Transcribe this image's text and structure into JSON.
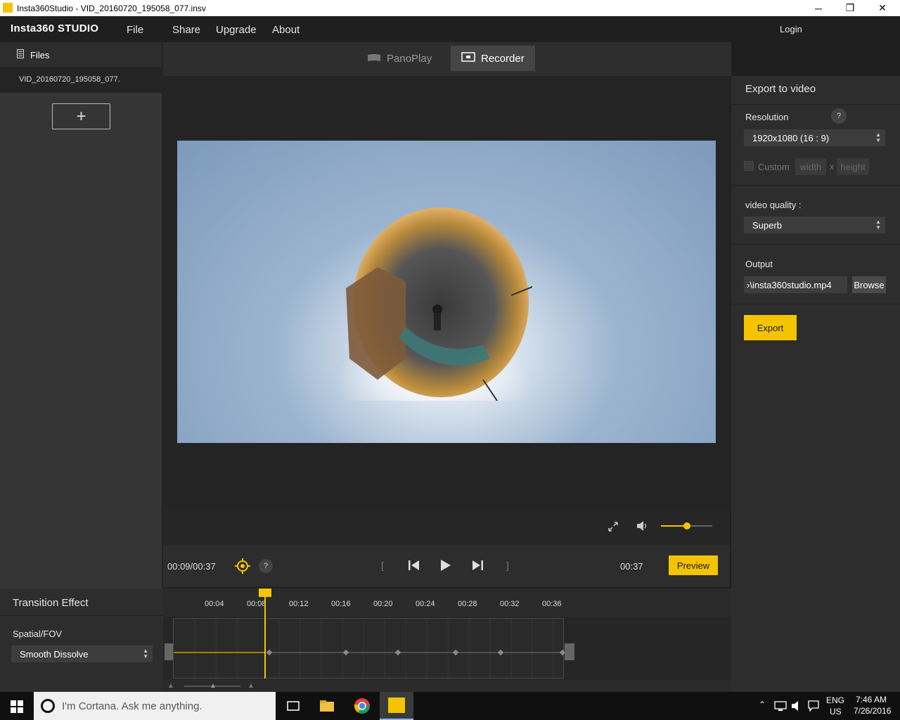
{
  "window": {
    "title": "Insta360Studio - VID_20160720_195058_077.insv",
    "minimize": "─",
    "restore": "❐",
    "close": "✕"
  },
  "menubar": {
    "brand": "Insta360 STUDIO",
    "items": [
      "File",
      "Share",
      "Upgrade",
      "About"
    ],
    "login": "Login"
  },
  "sidebar": {
    "files_label": "Files",
    "file_item": "VID_20160720_195058_077.",
    "add_label": "+"
  },
  "tabs": {
    "panoplay": "PanoPlay",
    "recorder": "Recorder"
  },
  "player": {
    "current_time": "00:09/00:37",
    "end_time": "00:37",
    "preview_label": "Preview",
    "help": "?",
    "volume_level": 0.5
  },
  "export": {
    "header": "Export to video",
    "resolution_label": "Resolution",
    "resolution_help": "?",
    "resolution_value": "1920x1080 (16 : 9)",
    "custom_label": "Custom",
    "width_placeholder": "width",
    "x_label": "x",
    "height_placeholder": "height",
    "quality_label": "video quality :",
    "quality_value": "Superb",
    "output_label": "Output",
    "output_value": "›\\insta360studio.mp4",
    "browse_label": "Browse",
    "export_label": "Export"
  },
  "transition": {
    "header": "Transition Effect",
    "spatial_label": "Spatial/FOV",
    "effect_value": "Smooth Dissolve"
  },
  "timeline": {
    "ticks": [
      "00:04",
      "00:08",
      "00:12",
      "00:16",
      "00:20",
      "00:24",
      "00:28",
      "00:32",
      "00:36"
    ]
  },
  "taskbar": {
    "cortana_placeholder": "I'm Cortana. Ask me anything.",
    "lang": "ENG",
    "region": "US",
    "time": "7:46 AM",
    "date": "7/26/2016"
  },
  "colors": {
    "accent": "#f5c400",
    "bg": "#1f1f1f",
    "panel": "#2d2d2d"
  }
}
